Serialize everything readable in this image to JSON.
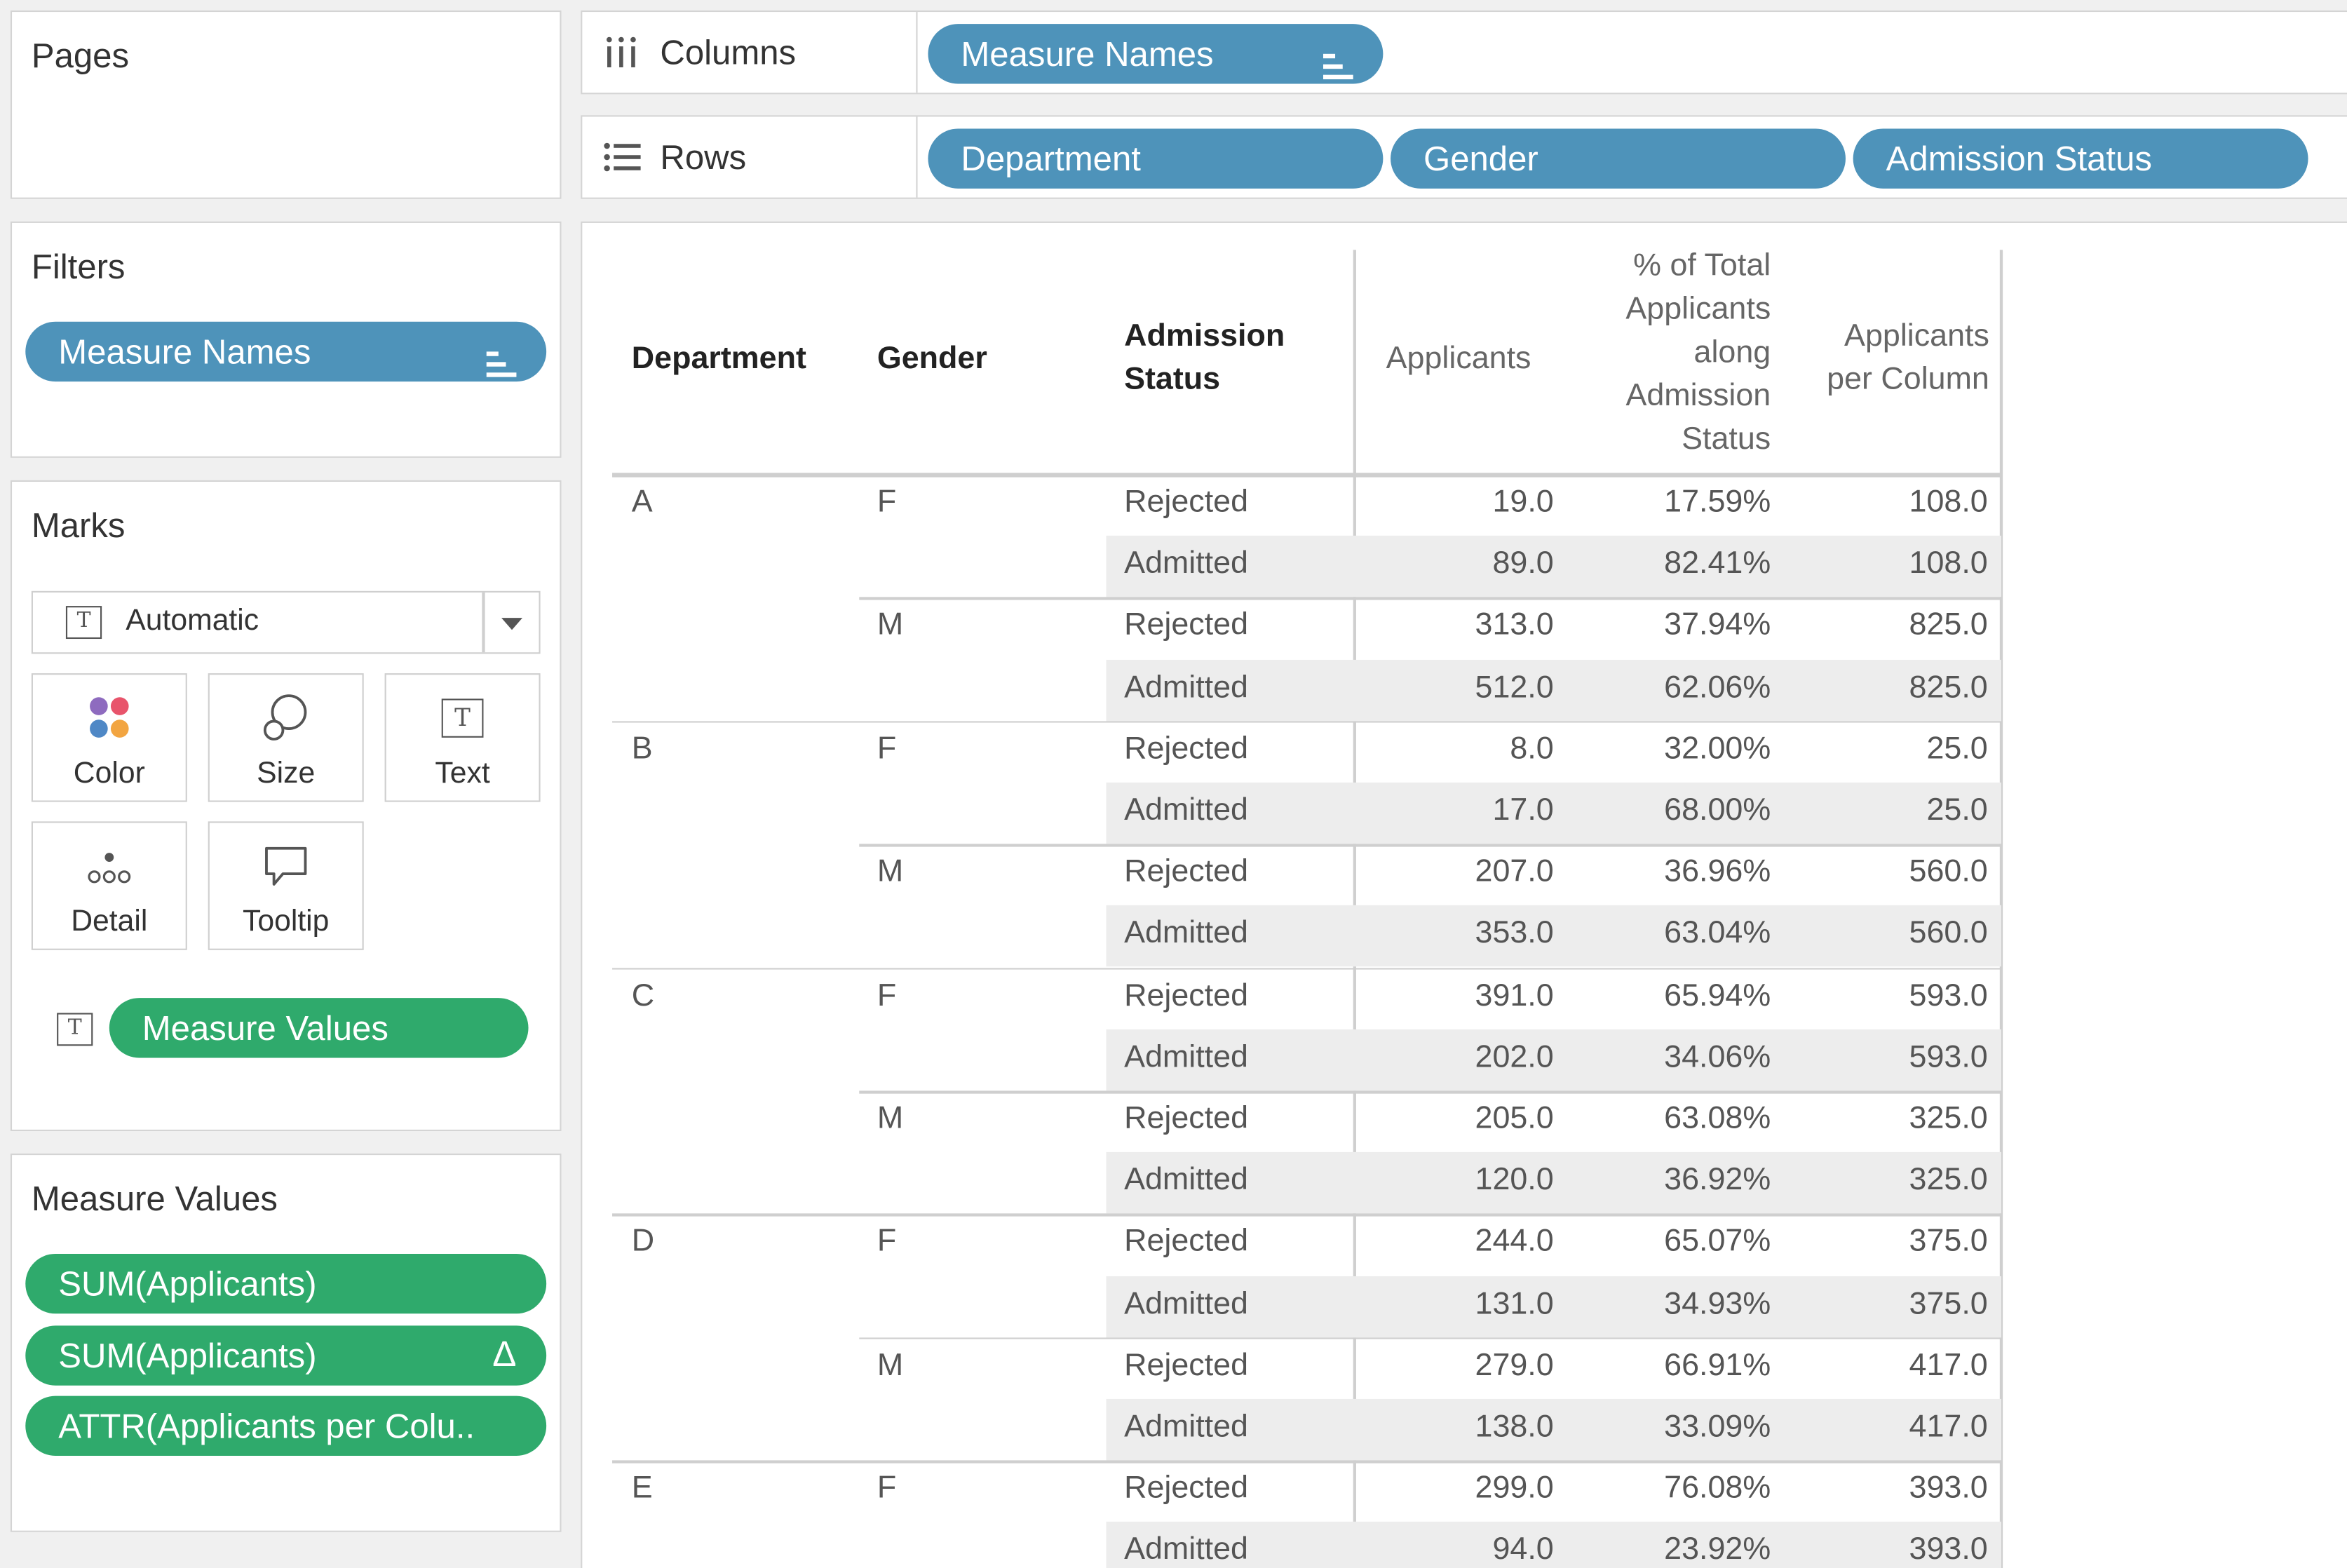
{
  "shelves": {
    "pages_title": "Pages",
    "columns_label": "Columns",
    "rows_label": "Rows",
    "columns_pills": [
      "Measure Names"
    ],
    "rows_pills": [
      "Department",
      "Gender",
      "Admission Status"
    ]
  },
  "filters": {
    "title": "Filters",
    "pills": [
      "Measure Names"
    ]
  },
  "marks": {
    "title": "Marks",
    "mark_type": "Automatic",
    "buttons": [
      "Color",
      "Size",
      "Text",
      "Detail",
      "Tooltip"
    ],
    "measure_values_pill": "Measure Values"
  },
  "measure_values": {
    "title": "Measure Values",
    "pills": [
      "SUM(Applicants)",
      "SUM(Applicants)",
      "ATTR(Applicants per Colu.."
    ]
  },
  "colors": {
    "dimension_pill": "#4e93ba",
    "measure_pill": "#2faa6c"
  },
  "table": {
    "headers": {
      "department": "Department",
      "gender": "Gender",
      "admission_status": [
        "Admission",
        "Status"
      ],
      "applicants": "Applicants",
      "pct_total": [
        "% of Total",
        "Applicants",
        "along",
        "Admission",
        "Status"
      ],
      "per_column": [
        "Applicants",
        "per Column"
      ]
    },
    "rows": [
      {
        "dept": "A",
        "gender": "F",
        "status": "Rejected",
        "applicants": "19.0",
        "pct": "17.59%",
        "per_col": "108.0"
      },
      {
        "dept": "",
        "gender": "",
        "status": "Admitted",
        "applicants": "89.0",
        "pct": "82.41%",
        "per_col": "108.0"
      },
      {
        "dept": "",
        "gender": "M",
        "status": "Rejected",
        "applicants": "313.0",
        "pct": "37.94%",
        "per_col": "825.0"
      },
      {
        "dept": "",
        "gender": "",
        "status": "Admitted",
        "applicants": "512.0",
        "pct": "62.06%",
        "per_col": "825.0"
      },
      {
        "dept": "B",
        "gender": "F",
        "status": "Rejected",
        "applicants": "8.0",
        "pct": "32.00%",
        "per_col": "25.0"
      },
      {
        "dept": "",
        "gender": "",
        "status": "Admitted",
        "applicants": "17.0",
        "pct": "68.00%",
        "per_col": "25.0"
      },
      {
        "dept": "",
        "gender": "M",
        "status": "Rejected",
        "applicants": "207.0",
        "pct": "36.96%",
        "per_col": "560.0"
      },
      {
        "dept": "",
        "gender": "",
        "status": "Admitted",
        "applicants": "353.0",
        "pct": "63.04%",
        "per_col": "560.0"
      },
      {
        "dept": "C",
        "gender": "F",
        "status": "Rejected",
        "applicants": "391.0",
        "pct": "65.94%",
        "per_col": "593.0"
      },
      {
        "dept": "",
        "gender": "",
        "status": "Admitted",
        "applicants": "202.0",
        "pct": "34.06%",
        "per_col": "593.0"
      },
      {
        "dept": "",
        "gender": "M",
        "status": "Rejected",
        "applicants": "205.0",
        "pct": "63.08%",
        "per_col": "325.0"
      },
      {
        "dept": "",
        "gender": "",
        "status": "Admitted",
        "applicants": "120.0",
        "pct": "36.92%",
        "per_col": "325.0"
      },
      {
        "dept": "D",
        "gender": "F",
        "status": "Rejected",
        "applicants": "244.0",
        "pct": "65.07%",
        "per_col": "375.0"
      },
      {
        "dept": "",
        "gender": "",
        "status": "Admitted",
        "applicants": "131.0",
        "pct": "34.93%",
        "per_col": "375.0"
      },
      {
        "dept": "",
        "gender": "M",
        "status": "Rejected",
        "applicants": "279.0",
        "pct": "66.91%",
        "per_col": "417.0"
      },
      {
        "dept": "",
        "gender": "",
        "status": "Admitted",
        "applicants": "138.0",
        "pct": "33.09%",
        "per_col": "417.0"
      },
      {
        "dept": "E",
        "gender": "F",
        "status": "Rejected",
        "applicants": "299.0",
        "pct": "76.08%",
        "per_col": "393.0"
      },
      {
        "dept": "",
        "gender": "",
        "status": "Admitted",
        "applicants": "94.0",
        "pct": "23.92%",
        "per_col": "393.0"
      }
    ]
  }
}
